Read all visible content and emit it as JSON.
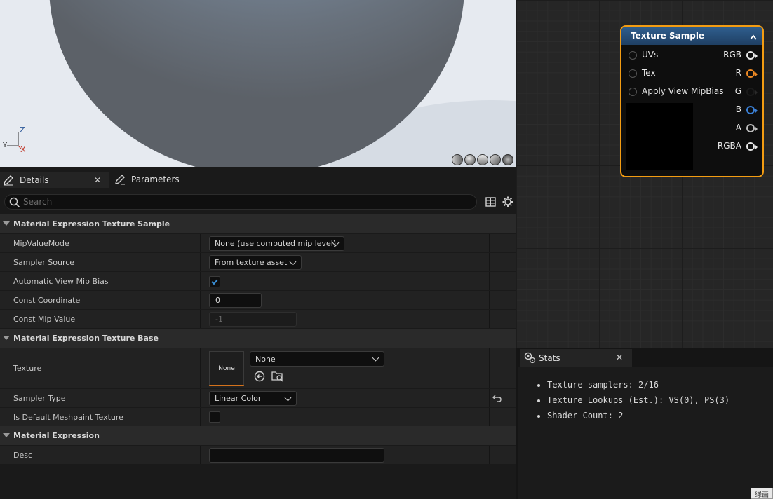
{
  "viewport": {
    "axis_z": "Z",
    "axis_y": "Y",
    "axis_x": "X"
  },
  "tabs": {
    "details": "Details",
    "parameters": "Parameters"
  },
  "search": {
    "placeholder": "Search"
  },
  "categories": {
    "texture_sample": "Material Expression Texture Sample",
    "texture_base": "Material Expression Texture Base",
    "expression": "Material Expression"
  },
  "props": {
    "mip_value_mode": {
      "label": "MipValueMode",
      "value": "None (use computed mip level)"
    },
    "sampler_source": {
      "label": "Sampler Source",
      "value": "From texture asset"
    },
    "auto_view_mip_bias": {
      "label": "Automatic View Mip Bias",
      "checked": true
    },
    "const_coordinate": {
      "label": "Const Coordinate",
      "value": "0"
    },
    "const_mip_value": {
      "label": "Const Mip Value",
      "value": "-1"
    },
    "texture": {
      "label": "Texture",
      "thumb": "None",
      "value": "None"
    },
    "sampler_type": {
      "label": "Sampler Type",
      "value": "Linear Color"
    },
    "is_default_meshpaint": {
      "label": "Is Default Meshpaint Texture",
      "checked": false
    },
    "desc": {
      "label": "Desc",
      "value": ""
    }
  },
  "node": {
    "title": "Texture Sample",
    "inputs": [
      "UVs",
      "Tex",
      "Apply View MipBias"
    ],
    "outputs": [
      {
        "label": "RGB",
        "color": "#e8e8e8"
      },
      {
        "label": "R",
        "color": "#f08a24"
      },
      {
        "label": "G",
        "color": "#3a8a3a"
      },
      {
        "label": "B",
        "color": "#3a7fd5"
      },
      {
        "label": "A",
        "color": "#bdbdbd"
      },
      {
        "label": "RGBA",
        "color": "#e8e8e8"
      }
    ]
  },
  "stats": {
    "tab": "Stats",
    "lines": [
      "Texture samplers: 2/16",
      "Texture Lookups (Est.): VS(0), PS(3)",
      "Shader Count: 2"
    ]
  },
  "ime": "绿画",
  "colors": {
    "accent": "#f39c12",
    "node_header": "#2f5f8f",
    "checkbox_accent": "#3a8fd6"
  }
}
